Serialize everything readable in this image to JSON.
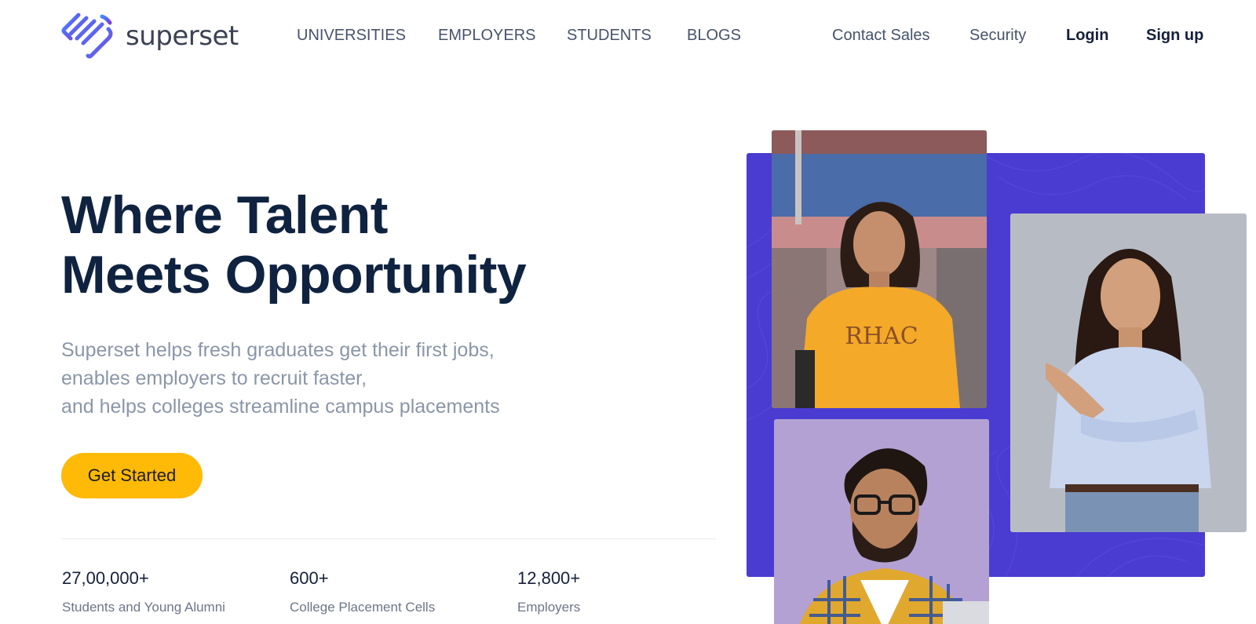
{
  "header": {
    "logo_text": "superset",
    "nav_main": [
      "UNIVERSITIES",
      "EMPLOYERS",
      "STUDENTS",
      "BLOGS"
    ],
    "contact_sales": "Contact Sales",
    "security": "Security",
    "login": "Login",
    "signup": "Sign up"
  },
  "hero": {
    "title_line1": "Where Talent",
    "title_line2": "Meets Opportunity",
    "subtitle_lines": [
      "Superset helps fresh graduates get their first jobs,",
      "enables employers to recruit faster,",
      "and helps colleges streamline campus placements"
    ],
    "cta_label": "Get Started",
    "stats": [
      {
        "value": "27,00,000+",
        "label": "Students and Young Alumni"
      },
      {
        "value": "600+",
        "label": "College Placement Cells"
      },
      {
        "value": "12,800+",
        "label": "Employers"
      }
    ],
    "photo_tshirt_text": "RHAC"
  },
  "colors": {
    "brand_dark": "#0f2340",
    "accent_yellow": "#ffba08",
    "panel_purple": "#4a3bd1",
    "logo_gradient_start": "#3d8bff",
    "logo_gradient_end": "#7b3fe4"
  },
  "icons": [
    "superset-logo-icon"
  ]
}
